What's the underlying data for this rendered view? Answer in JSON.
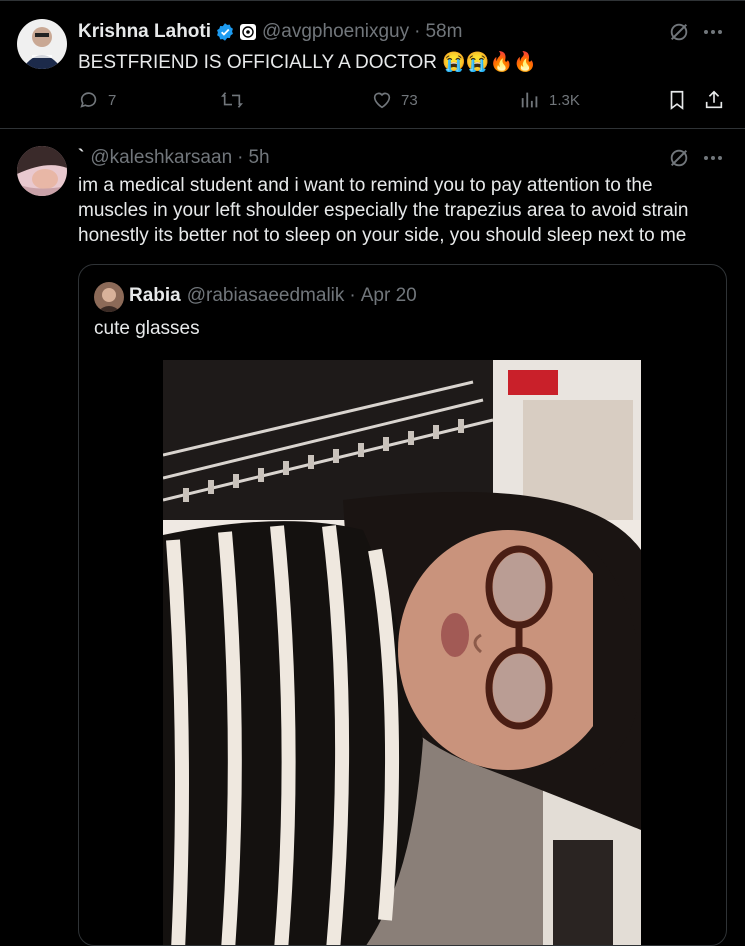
{
  "tweet1": {
    "name": "Krishna Lahoti",
    "handle": "@avgphoenixguy",
    "separator": "·",
    "time": "58m",
    "text": "BESTFRIEND IS OFFICIALLY A DOCTOR 😭😭🔥🔥",
    "stats": {
      "replies": "7",
      "likes": "73",
      "views": "1.3K"
    }
  },
  "tweet2": {
    "name": "`",
    "handle": "@kaleshkarsaan",
    "separator": "·",
    "time": "5h",
    "text": "im a medical student and i want to remind you to pay attention to the muscles in your left shoulder especially the trapezius area to avoid strain honestly its better not to sleep on your side, you should sleep next to me"
  },
  "quote": {
    "name": "Rabia",
    "handle": "@rabiasaeedmalik",
    "separator": "·",
    "time": "Apr 20",
    "text": "cute glasses"
  },
  "icons": {
    "verified": "verified-badge-icon",
    "grok": "grok-icon",
    "more": "more-icon",
    "reply": "reply-icon",
    "retweet": "retweet-icon",
    "like": "heart-icon",
    "views": "views-icon",
    "bookmark": "bookmark-icon",
    "share": "share-icon"
  },
  "colors": {
    "background": "#000000",
    "text": "#e7e9ea",
    "muted": "#71767b",
    "border": "#2f3336",
    "verified": "#1d9bf0"
  }
}
